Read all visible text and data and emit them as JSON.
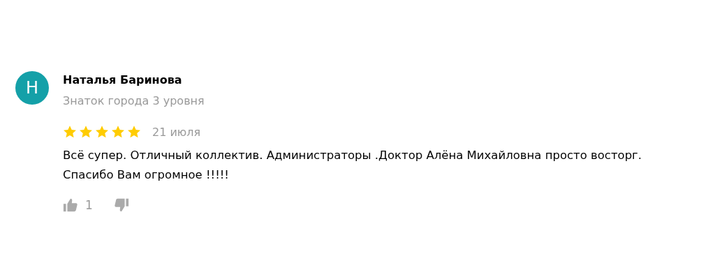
{
  "review": {
    "avatar": {
      "letter": "Н",
      "color": "#14a0a8"
    },
    "author": "Наталья Баринова",
    "author_level": "Знаток города 3 уровня",
    "stars": 5,
    "date": "21 июля",
    "text": "Всё супер. Отличный коллектив. Администраторы .Доктор Алёна Михайловна просто восторг. Спасибо Вам огромное !!!!!",
    "likes": "1"
  }
}
